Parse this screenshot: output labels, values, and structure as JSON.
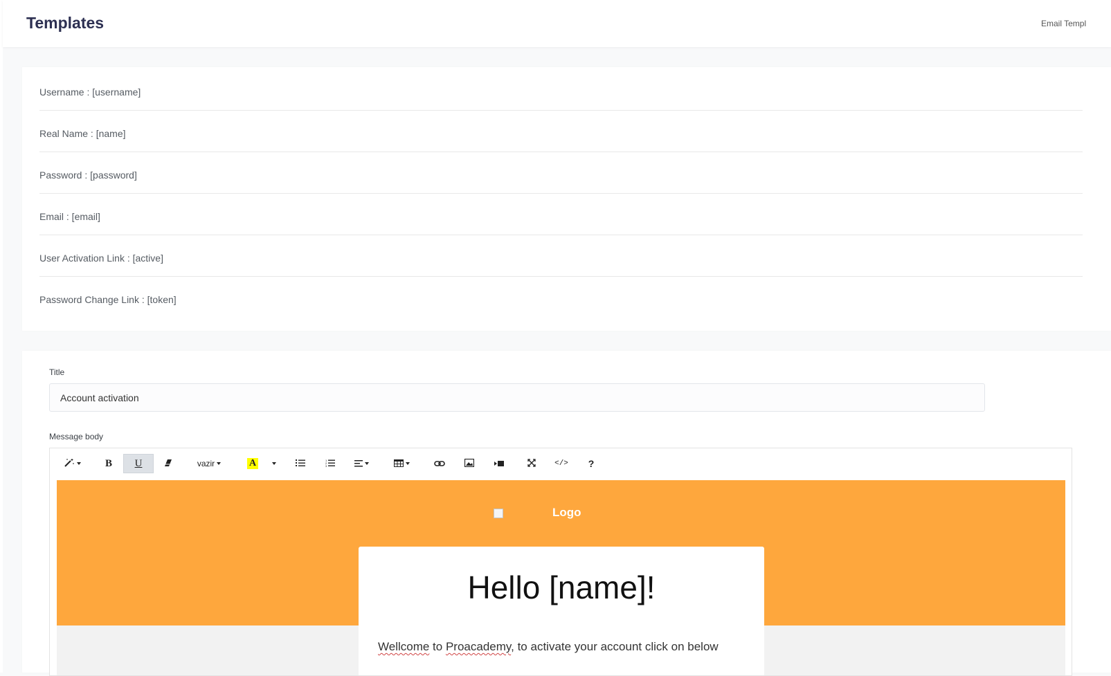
{
  "header": {
    "title": "Templates",
    "breadcrumb": "Email Templ"
  },
  "variables": [
    "Username : [username]",
    "Real Name : [name]",
    "Password : [password]",
    "Email : [email]",
    "User Activation Link : [active]",
    "Password Change Link : [token]"
  ],
  "form": {
    "title_label": "Title",
    "title_value": "Account activation",
    "body_label": "Message body"
  },
  "toolbar": {
    "style_icon": "magic-wand-icon",
    "bold": "B",
    "underline": "U",
    "eraser_icon": "eraser-icon",
    "font_name": "vazir",
    "color_glyph": "A",
    "color_highlight": "#ffff00",
    "ul_icon": "unordered-list-icon",
    "ol_icon": "ordered-list-icon",
    "align_icon": "align-icon",
    "table_icon": "table-icon",
    "link_icon": "link-icon",
    "picture_icon": "image-icon",
    "video_icon": "video-icon",
    "fullscreen_icon": "fullscreen-icon",
    "code_glyph": "</>",
    "help_glyph": "?"
  },
  "email_preview": {
    "logo_alt": "Logo",
    "greeting": "Hello [name]!",
    "welcome_word": "Wellcome",
    "to_word": " to ",
    "brand_word": "Proacademy",
    "rest": ", to activate your account click on below",
    "band_color": "#fea73d"
  }
}
